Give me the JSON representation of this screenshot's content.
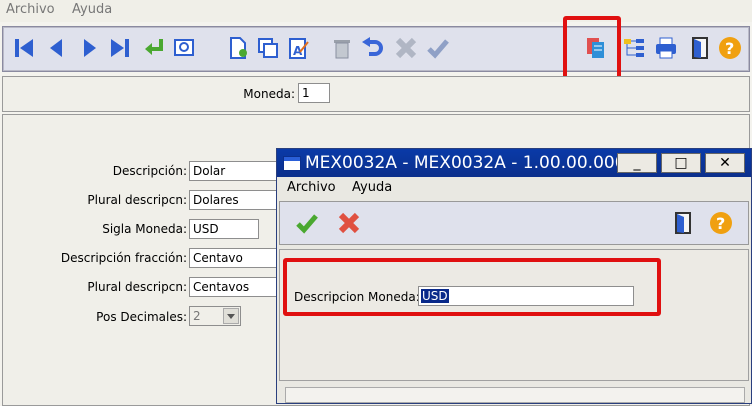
{
  "menu": {
    "archivo": "Archivo",
    "ayuda": "Ayuda"
  },
  "toolbar": {
    "icons": [
      "first-record-icon",
      "prev-record-icon",
      "next-record-icon",
      "last-record-icon",
      "enter-icon",
      "view-icon",
      "new-doc-icon",
      "copy-icon",
      "edit-icon",
      "delete-icon",
      "undo-icon",
      "cancel-icon",
      "accept-icon",
      "report-icon",
      "tree-icon",
      "print-icon",
      "exit-door-icon",
      "help-icon"
    ]
  },
  "header": {
    "moneda_label": "Moneda:",
    "moneda_value": "1"
  },
  "form": {
    "descripcion_label": "Descripción:",
    "descripcion_value": "Dolar",
    "plural1_label": "Plural descripcn:",
    "plural1_value": "Dolares",
    "sigla_label": "Sigla Moneda:",
    "sigla_value": "USD",
    "fraccion_label": "Descripción fracción:",
    "fraccion_value": "Centavo",
    "plural2_label": "Plural descripcn:",
    "plural2_value": "Centavos",
    "pos_label": "Pos Decimales:",
    "pos_value": "2"
  },
  "dialog": {
    "title": "MEX0032A - MEX0032A - 1.00.00.000...",
    "menu": {
      "archivo": "Archivo",
      "ayuda": "Ayuda"
    },
    "field_label": "Descripcion Moneda:",
    "field_value": "USD",
    "btn_min": "_",
    "btn_max": "□",
    "btn_close": "✕"
  },
  "colors": {
    "highlight_red": "#e01010",
    "title_blue": "#0a3aa8"
  }
}
